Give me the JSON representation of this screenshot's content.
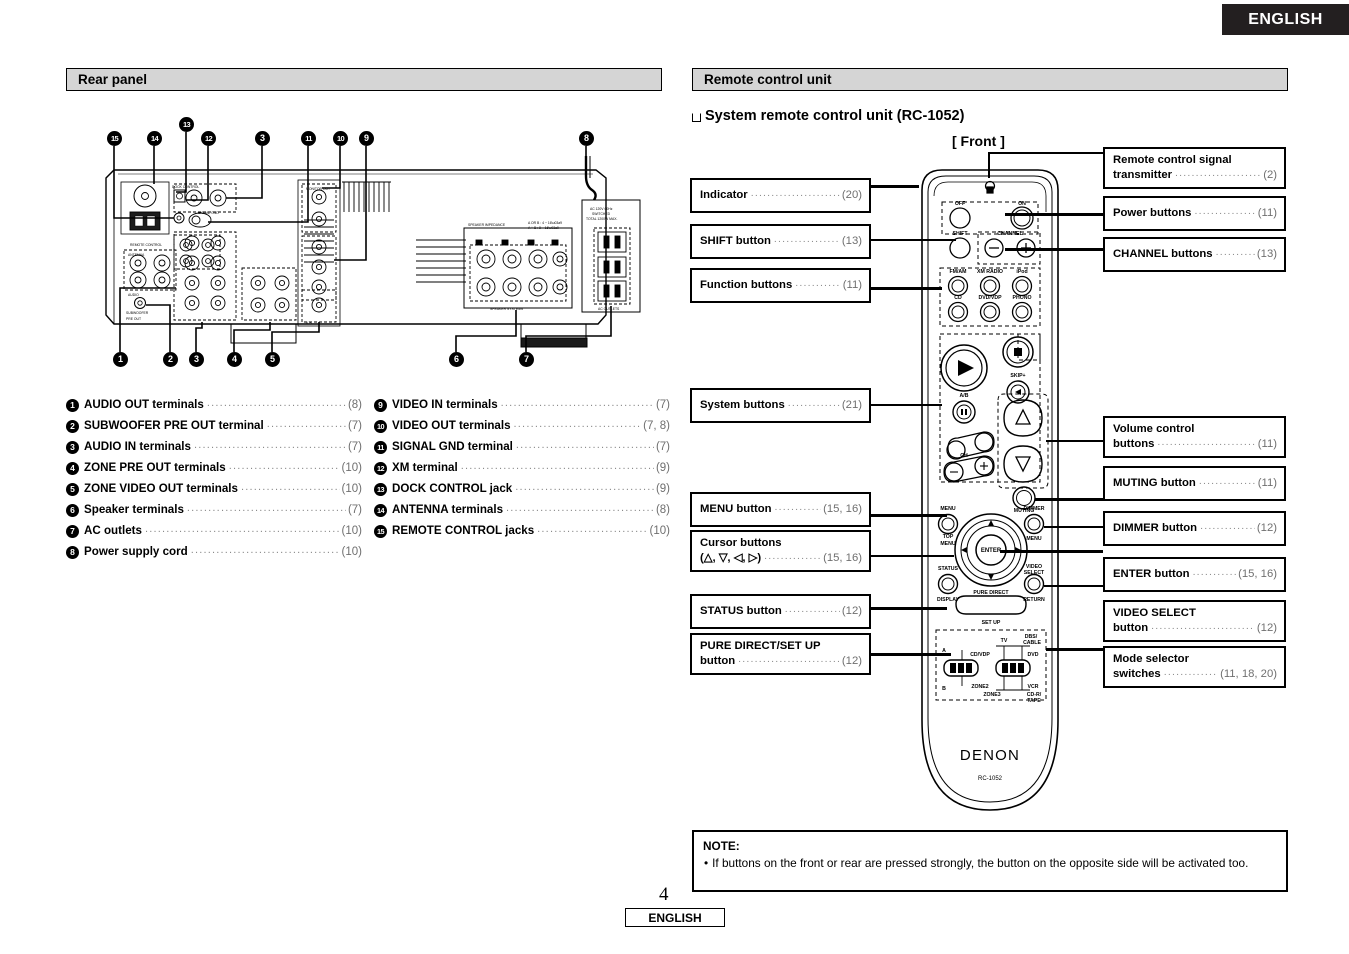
{
  "header": {
    "language_tab": "ENGLISH"
  },
  "sections": {
    "rear_panel_title": "Rear panel",
    "remote_title": "Remote control unit"
  },
  "remote": {
    "subtitle": "System remote control unit (RC-1052)",
    "view_label": "[ Front ]",
    "brand": "DENON",
    "model": "RC-1052",
    "button_labels": {
      "off": "OFF",
      "on": "ON",
      "shift": "SHIFT",
      "channel": "CHANNEL",
      "channel_minus": "–",
      "channel_plus": "+",
      "fm_am": "FM/AM",
      "xm_radio": "XM RADIO",
      "ipod": "iPod",
      "cd": "CD",
      "dvd_vdp": "DVD/VDP",
      "phono": "PHONO",
      "skip_plus": "SKIP+",
      "ab": "A/B",
      "ch": "CH",
      "muting": "MUTING",
      "menu": "MENU",
      "top_menu": "TOP MENU",
      "dimmer": "DIMMER",
      "dimmer_menu": "MENU",
      "enter": "ENTER",
      "status": "STATUS",
      "display": "DISPLAY",
      "video_select": "VIDEO SELECT",
      "return": "RETURN",
      "pure_direct": "PURE DIRECT",
      "set_up": "SET UP",
      "sw_a": "A",
      "sw_b": "B",
      "sw_cd_vdp": "CD/VDP",
      "sw_zone2": "ZONE2",
      "sw_zone3": "ZONE3",
      "sw_tv": "TV",
      "sw_dbs_cable": "DBS/CABLE",
      "sw_dvd": "DVD",
      "sw_vcr": "VCR",
      "sw_cdr_tape": "CD-R/TAPE"
    }
  },
  "rear_callouts": {
    "top_markers": [
      "15",
      "14",
      "13",
      "12",
      "3",
      "11",
      "10",
      "9",
      "8"
    ],
    "bottom_markers": [
      "1",
      "2",
      "3",
      "4",
      "5",
      "6",
      "7"
    ]
  },
  "rear_legend_left": [
    {
      "num": "1",
      "label": "AUDIO OUT terminals",
      "page": "(8)"
    },
    {
      "num": "2",
      "label": "SUBWOOFER PRE OUT terminal",
      "page": "(7)"
    },
    {
      "num": "3",
      "label": "AUDIO IN terminals",
      "page": "(7)"
    },
    {
      "num": "4",
      "label": "ZONE PRE OUT terminals",
      "page": "(10)"
    },
    {
      "num": "5",
      "label": "ZONE VIDEO OUT terminals",
      "page": "(10)"
    },
    {
      "num": "6",
      "label": "Speaker terminals",
      "page": "(7)"
    },
    {
      "num": "7",
      "label": "AC outlets",
      "page": "(10)"
    },
    {
      "num": "8",
      "label": "Power supply cord",
      "page": "(10)"
    }
  ],
  "rear_legend_right": [
    {
      "num": "9",
      "label": "VIDEO IN terminals",
      "page": "(7)"
    },
    {
      "num": "10",
      "label": "VIDEO OUT terminals",
      "page": "(7, 8)"
    },
    {
      "num": "11",
      "label": "SIGNAL GND terminal",
      "page": "(7)"
    },
    {
      "num": "12",
      "label": "XM terminal",
      "page": "(9)"
    },
    {
      "num": "13",
      "label": "DOCK CONTROL jack",
      "page": "(9)"
    },
    {
      "num": "14",
      "label": "ANTENNA terminals",
      "page": "(8)"
    },
    {
      "num": "15",
      "label": "REMOTE CONTROL jacks",
      "page": "(10)"
    }
  ],
  "remote_callouts_left": [
    {
      "id": "indicator",
      "label": "Indicator",
      "page": "(20)"
    },
    {
      "id": "shift-button",
      "label": "SHIFT button",
      "page": "(13)"
    },
    {
      "id": "function-buttons",
      "label": "Function buttons",
      "page": "(11)"
    },
    {
      "id": "system-buttons",
      "label": "System buttons",
      "page": "(21)"
    },
    {
      "id": "menu-button",
      "label": "MENU button",
      "page": "(15, 16)"
    },
    {
      "id": "cursor-buttons",
      "label": "Cursor buttons",
      "label2": "(△, ▽, ◁, ▷)",
      "page": "(15, 16)"
    },
    {
      "id": "status-button",
      "label": "STATUS button",
      "page": "(12)"
    },
    {
      "id": "pure-direct-button",
      "label": "PURE DIRECT/SET UP",
      "label2": "button",
      "page": "(12)"
    }
  ],
  "remote_callouts_right": [
    {
      "id": "signal-transmitter",
      "label": "Remote control signal",
      "label2": "transmitter",
      "page": "(2)"
    },
    {
      "id": "power-buttons",
      "label": "Power buttons",
      "page": "(11)"
    },
    {
      "id": "channel-buttons",
      "label": "CHANNEL buttons",
      "page": "(13)"
    },
    {
      "id": "volume-control-buttons",
      "label": "Volume control",
      "label2": "buttons",
      "page": "(11)"
    },
    {
      "id": "muting-button",
      "label": "MUTING button",
      "page": "(11)"
    },
    {
      "id": "dimmer-button",
      "label": "DIMMER button",
      "page": "(12)"
    },
    {
      "id": "enter-button",
      "label": "ENTER button",
      "page": "(15, 16)"
    },
    {
      "id": "video-select-button",
      "label": "VIDEO SELECT",
      "label2": "button",
      "page": "(12)"
    },
    {
      "id": "mode-selector-switches",
      "label": "Mode selector",
      "label2": "switches",
      "page": "(11, 18, 20)"
    }
  ],
  "note": {
    "title": "NOTE:",
    "items": [
      "If buttons on the front or rear are pressed strongly, the button on the opposite side will be activated too."
    ]
  },
  "footer": {
    "page_number": "4",
    "language": "ENGLISH"
  },
  "rear_panel_text": {
    "speaker_impedance": "SPEAKER IMPEDANCE",
    "speaker_note1": "A OR B : 4 ~ 16Ω",
    "speaker_note2": "A + B : 8 ~ 16Ω",
    "speaker_systems": "SPEAKER SYSTEMS",
    "ac_outlets_title1": "AC 120V 60Hz",
    "ac_outlets_title2": "SWITCHED",
    "ac_outlets_title3": "TOTAL 1200W MAX.",
    "ac_outlets_label": "AC OUTLETS",
    "pre_out": "PRE OUT",
    "subwoofer": "SUBWOOFER",
    "antenna": "ANTENNA",
    "audio": "AUDIO",
    "dock_control": "DOCK CONTROL",
    "remote_control": "REMOTE CONTROL",
    "signal_gnd": "SIGNAL GND",
    "monitor_out": "MONITOR OUT",
    "video": "VIDEO",
    "xm": "XM"
  },
  "colors": {
    "header_bg": "#231f20",
    "section_bar_bg": "#d5d5d5",
    "dots": "#8a8a8a",
    "page_ref": "#6f6f6f",
    "line": "#000000"
  }
}
